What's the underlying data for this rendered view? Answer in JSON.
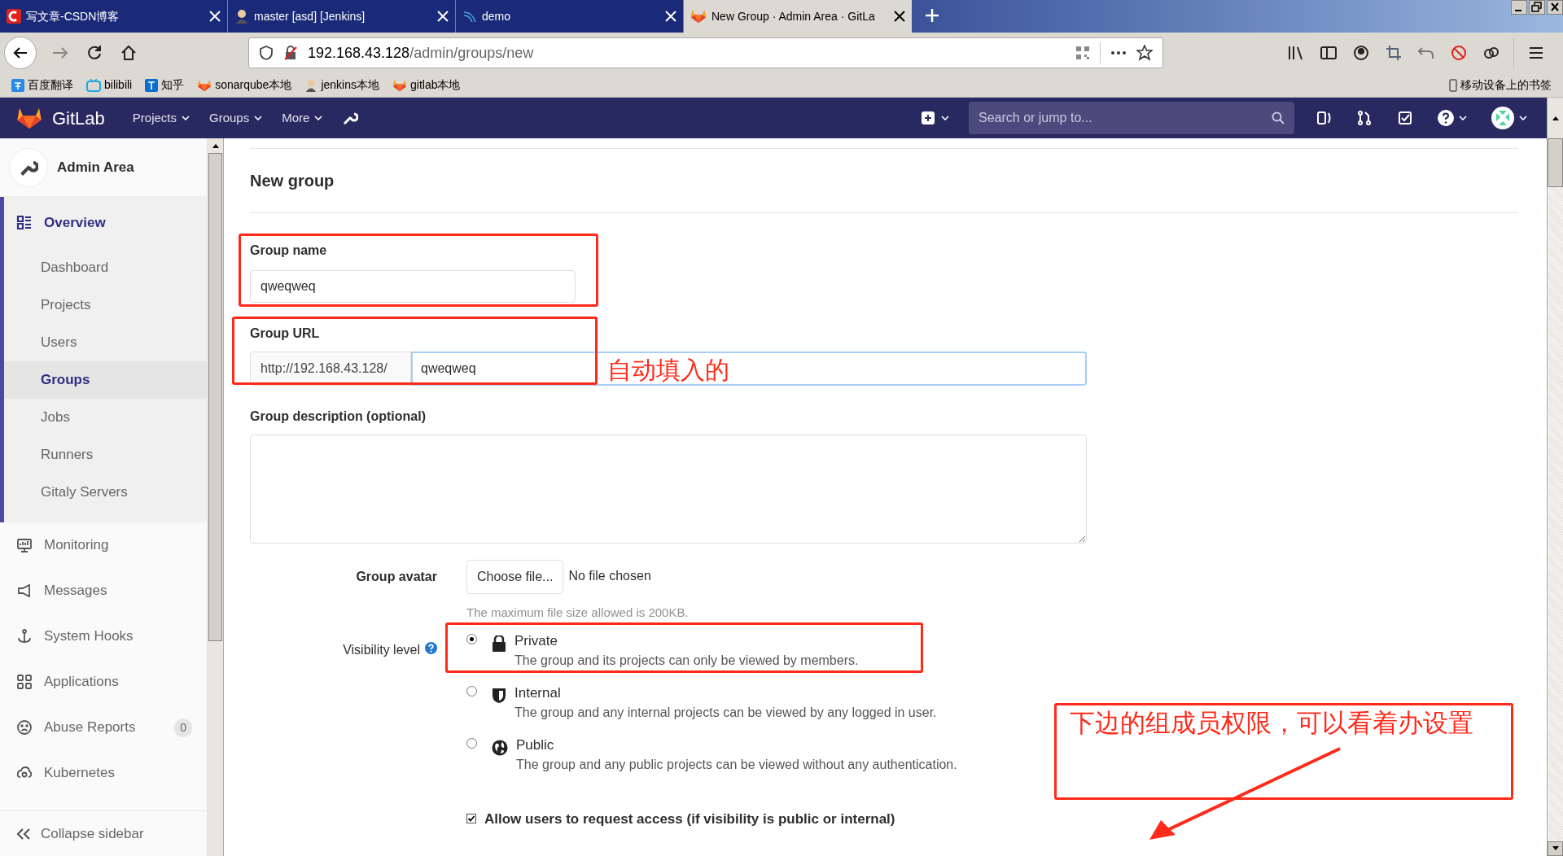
{
  "browser": {
    "tabs": [
      {
        "title": "写文章-CSDN博客",
        "selected": false
      },
      {
        "title": "master [asd] [Jenkins]",
        "selected": false
      },
      {
        "title": "demo",
        "selected": false
      },
      {
        "title": "New Group · Admin Area · GitLa",
        "selected": true
      }
    ],
    "address": {
      "host": "192.168.43.128",
      "path": "/admin/groups/new"
    },
    "bookmarks": [
      "百度翻译",
      "bilibili",
      "知乎",
      "sonarqube本地",
      "jenkins本地",
      "gitlab本地"
    ],
    "mobile_bookmarks": "移动设备上的书签"
  },
  "header": {
    "brand": "GitLab",
    "nav": [
      "Projects",
      "Groups",
      "More"
    ],
    "search": {
      "placeholder": "Search or jump to..."
    }
  },
  "sidebar": {
    "title": "Admin Area",
    "items": [
      {
        "label": "Overview",
        "selected": true,
        "children": [
          {
            "label": "Dashboard",
            "selected": false
          },
          {
            "label": "Projects",
            "selected": false
          },
          {
            "label": "Users",
            "selected": false
          },
          {
            "label": "Groups",
            "selected": true
          },
          {
            "label": "Jobs",
            "selected": false
          },
          {
            "label": "Runners",
            "selected": false
          },
          {
            "label": "Gitaly Servers",
            "selected": false
          }
        ]
      },
      {
        "label": "Monitoring",
        "selected": false
      },
      {
        "label": "Messages",
        "selected": false
      },
      {
        "label": "System Hooks",
        "selected": false
      },
      {
        "label": "Applications",
        "selected": false
      },
      {
        "label": "Abuse Reports",
        "selected": false,
        "badge": "0"
      },
      {
        "label": "Kubernetes",
        "selected": false
      }
    ],
    "collapse": "Collapse sidebar"
  },
  "form": {
    "title": "New group",
    "group_name": {
      "label": "Group name",
      "value": "qweqweq"
    },
    "group_url": {
      "label": "Group URL",
      "prefix": "http://192.168.43.128/",
      "value": "qweqweq"
    },
    "description": {
      "label": "Group description (optional)"
    },
    "avatar": {
      "label": "Group avatar",
      "button": "Choose file...",
      "status": "No file chosen",
      "hint": "The maximum file size allowed is 200KB."
    },
    "visibility": {
      "label": "Visibility level",
      "options": [
        {
          "label": "Private",
          "description": "The group and its projects can only be viewed by members.",
          "selected": true
        },
        {
          "label": "Internal",
          "description": "The group and any internal projects can be viewed by any logged in user.",
          "selected": false
        },
        {
          "label": "Public",
          "description": "The group and any public projects can be viewed without any authentication.",
          "selected": false
        }
      ]
    },
    "request_access": {
      "label": "Allow users to request access (if visibility is public or internal)",
      "checked": true
    }
  },
  "annotations": [
    {
      "text": "自动填入的"
    },
    {
      "text": "下边的组成员权限，可以看着办设置"
    }
  ]
}
